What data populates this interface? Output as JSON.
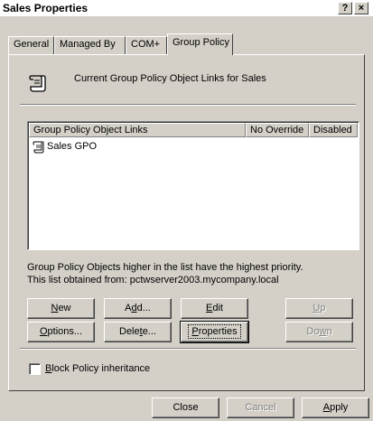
{
  "window": {
    "title": "Sales Properties",
    "help_glyph": "?",
    "close_glyph": "×"
  },
  "tabs": [
    {
      "label": "General",
      "active": false
    },
    {
      "label": "Managed By",
      "active": false
    },
    {
      "label": "COM+",
      "active": false
    },
    {
      "label": "Group Policy",
      "active": true
    }
  ],
  "header": {
    "icon": "gpo-scroll-icon",
    "text": "Current Group Policy Object Links for Sales"
  },
  "list": {
    "columns": [
      "Group Policy Object Links",
      "No Override",
      "Disabled"
    ],
    "rows": [
      {
        "icon": "gpo-scroll-icon",
        "name": "Sales GPO",
        "no_override": "",
        "disabled": ""
      }
    ]
  },
  "info": {
    "line1": "Group Policy Objects higher in the list have the highest priority.",
    "line2": "This list obtained from: pctwserver2003.mycompany.local"
  },
  "buttons": {
    "new": {
      "pre": "",
      "hot": "N",
      "post": "ew"
    },
    "add": {
      "pre": "A",
      "hot": "d",
      "post": "d..."
    },
    "edit": {
      "pre": "",
      "hot": "E",
      "post": "dit"
    },
    "up": {
      "pre": "",
      "hot": "U",
      "post": "p"
    },
    "options": {
      "pre": "",
      "hot": "O",
      "post": "ptions..."
    },
    "delete": {
      "pre": "Dele",
      "hot": "t",
      "post": "e..."
    },
    "properties": {
      "pre": "",
      "hot": "P",
      "post": "roperties"
    },
    "down": {
      "pre": "Do",
      "hot": "w",
      "post": "n"
    }
  },
  "block_inheritance": {
    "pre": "",
    "hot": "B",
    "post": "lock Policy inheritance",
    "checked": false
  },
  "footer": {
    "close": "Close",
    "cancel": "Cancel",
    "apply": {
      "pre": "",
      "hot": "A",
      "post": "pply"
    }
  }
}
